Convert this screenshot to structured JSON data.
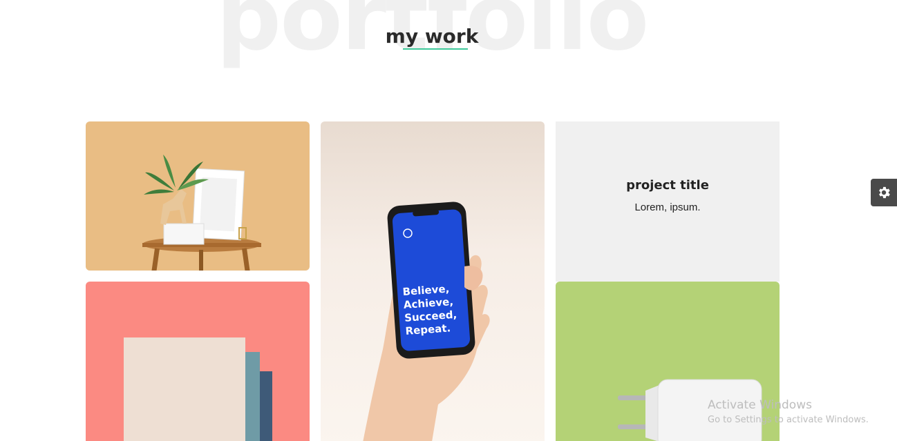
{
  "section": {
    "background_word": "portfolio",
    "heading": "my work",
    "accent_color": "#3ec99a"
  },
  "portfolio": {
    "items": [
      {
        "kind": "image",
        "subject": "frame-and-plant-on-side-table"
      },
      {
        "kind": "image",
        "subject": "hand-holding-phone",
        "screen_text": [
          "Believe,",
          "Achieve,",
          "Succeed,",
          "Repeat."
        ]
      },
      {
        "kind": "text",
        "title": "project title",
        "description": "Lorem, ipsum."
      },
      {
        "kind": "image",
        "subject": "paper-cards-on-pink"
      },
      {
        "kind": "image",
        "subject": "white-charger-on-green"
      }
    ]
  },
  "settings": {
    "icon": "gear-icon"
  },
  "watermark": {
    "title": "Activate Windows",
    "subtitle": "Go to Settings to activate Windows."
  }
}
